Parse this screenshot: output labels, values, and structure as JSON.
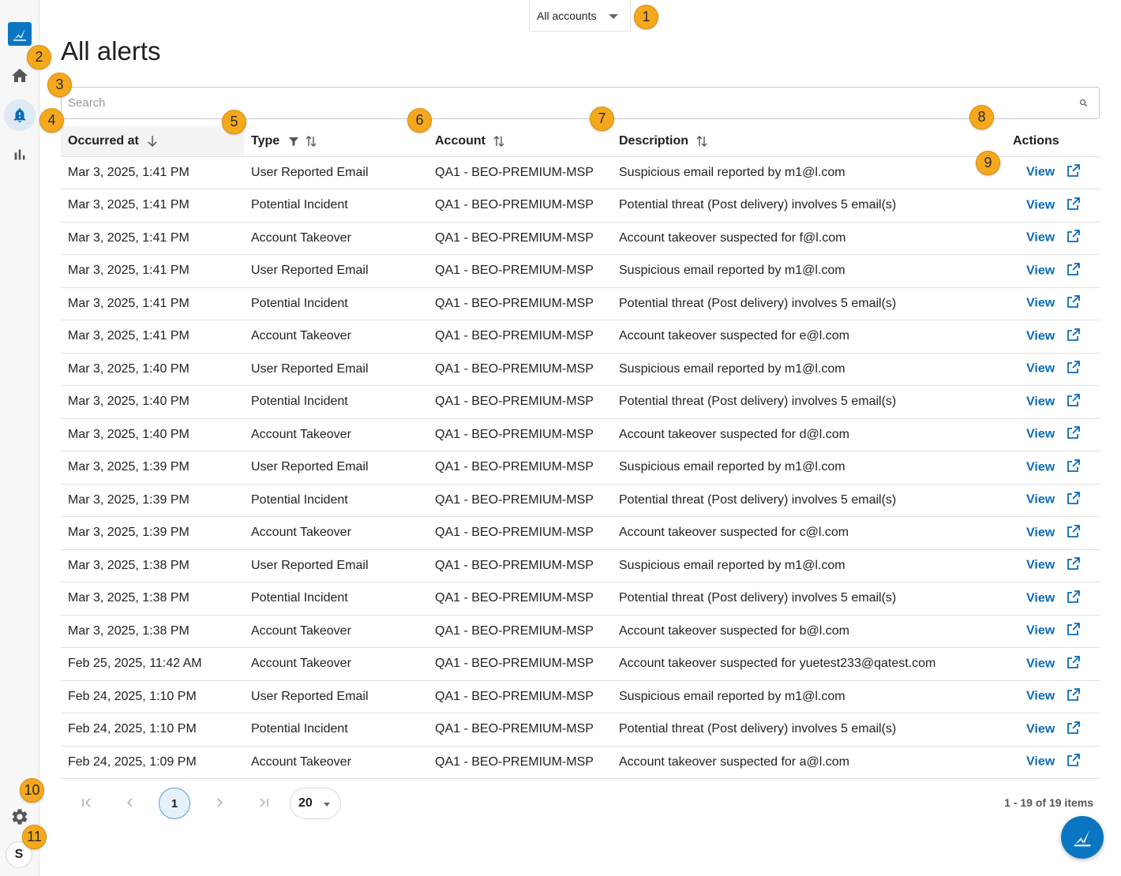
{
  "account_selector": {
    "value": "All accounts"
  },
  "page": {
    "title": "All alerts"
  },
  "search": {
    "placeholder": "Search"
  },
  "table": {
    "columns": [
      "Occurred at",
      "Type",
      "Account",
      "Description",
      "Actions"
    ],
    "rows": [
      {
        "occurred": "Mar 3, 2025, 1:41 PM",
        "type": "User Reported Email",
        "account": "QA1 - BEO-PREMIUM-MSP",
        "description": "Suspicious email reported by m1@l.com",
        "action": "View"
      },
      {
        "occurred": "Mar 3, 2025, 1:41 PM",
        "type": "Potential Incident",
        "account": "QA1 - BEO-PREMIUM-MSP",
        "description": "Potential threat (Post delivery) involves 5 email(s)",
        "action": "View"
      },
      {
        "occurred": "Mar 3, 2025, 1:41 PM",
        "type": "Account Takeover",
        "account": "QA1 - BEO-PREMIUM-MSP",
        "description": "Account takeover suspected for f@l.com",
        "action": "View"
      },
      {
        "occurred": "Mar 3, 2025, 1:41 PM",
        "type": "User Reported Email",
        "account": "QA1 - BEO-PREMIUM-MSP",
        "description": "Suspicious email reported by m1@l.com",
        "action": "View"
      },
      {
        "occurred": "Mar 3, 2025, 1:41 PM",
        "type": "Potential Incident",
        "account": "QA1 - BEO-PREMIUM-MSP",
        "description": "Potential threat (Post delivery) involves 5 email(s)",
        "action": "View"
      },
      {
        "occurred": "Mar 3, 2025, 1:41 PM",
        "type": "Account Takeover",
        "account": "QA1 - BEO-PREMIUM-MSP",
        "description": "Account takeover suspected for e@l.com",
        "action": "View"
      },
      {
        "occurred": "Mar 3, 2025, 1:40 PM",
        "type": "User Reported Email",
        "account": "QA1 - BEO-PREMIUM-MSP",
        "description": "Suspicious email reported by m1@l.com",
        "action": "View"
      },
      {
        "occurred": "Mar 3, 2025, 1:40 PM",
        "type": "Potential Incident",
        "account": "QA1 - BEO-PREMIUM-MSP",
        "description": "Potential threat (Post delivery) involves 5 email(s)",
        "action": "View"
      },
      {
        "occurred": "Mar 3, 2025, 1:40 PM",
        "type": "Account Takeover",
        "account": "QA1 - BEO-PREMIUM-MSP",
        "description": "Account takeover suspected for d@l.com",
        "action": "View"
      },
      {
        "occurred": "Mar 3, 2025, 1:39 PM",
        "type": "User Reported Email",
        "account": "QA1 - BEO-PREMIUM-MSP",
        "description": "Suspicious email reported by m1@l.com",
        "action": "View"
      },
      {
        "occurred": "Mar 3, 2025, 1:39 PM",
        "type": "Potential Incident",
        "account": "QA1 - BEO-PREMIUM-MSP",
        "description": "Potential threat (Post delivery) involves 5 email(s)",
        "action": "View"
      },
      {
        "occurred": "Mar 3, 2025, 1:39 PM",
        "type": "Account Takeover",
        "account": "QA1 - BEO-PREMIUM-MSP",
        "description": "Account takeover suspected for c@l.com",
        "action": "View"
      },
      {
        "occurred": "Mar 3, 2025, 1:38 PM",
        "type": "User Reported Email",
        "account": "QA1 - BEO-PREMIUM-MSP",
        "description": "Suspicious email reported by m1@l.com",
        "action": "View"
      },
      {
        "occurred": "Mar 3, 2025, 1:38 PM",
        "type": "Potential Incident",
        "account": "QA1 - BEO-PREMIUM-MSP",
        "description": "Potential threat (Post delivery) involves 5 email(s)",
        "action": "View"
      },
      {
        "occurred": "Mar 3, 2025, 1:38 PM",
        "type": "Account Takeover",
        "account": "QA1 - BEO-PREMIUM-MSP",
        "description": "Account takeover suspected for b@l.com",
        "action": "View"
      },
      {
        "occurred": "Feb 25, 2025, 11:42 AM",
        "type": "Account Takeover",
        "account": "QA1 - BEO-PREMIUM-MSP",
        "description": "Account takeover suspected for yuetest233@qatest.com",
        "action": "View"
      },
      {
        "occurred": "Feb 24, 2025, 1:10 PM",
        "type": "User Reported Email",
        "account": "QA1 - BEO-PREMIUM-MSP",
        "description": "Suspicious email reported by m1@l.com",
        "action": "View"
      },
      {
        "occurred": "Feb 24, 2025, 1:10 PM",
        "type": "Potential Incident",
        "account": "QA1 - BEO-PREMIUM-MSP",
        "description": "Potential threat (Post delivery) involves 5 email(s)",
        "action": "View"
      },
      {
        "occurred": "Feb 24, 2025, 1:09 PM",
        "type": "Account Takeover",
        "account": "QA1 - BEO-PREMIUM-MSP",
        "description": "Account takeover suspected for a@l.com",
        "action": "View"
      }
    ]
  },
  "pagination": {
    "current_page": "1",
    "page_size": "20",
    "info": "1 - 19 of 19 items"
  },
  "sidebar": {
    "items": [
      {
        "name": "home",
        "icon": "home-icon"
      },
      {
        "name": "alerts",
        "icon": "bell-alert-icon",
        "active": true
      },
      {
        "name": "reports",
        "icon": "bar-chart-icon"
      }
    ],
    "avatar_initial": "S"
  },
  "callouts": [
    "1",
    "2",
    "3",
    "4",
    "5",
    "6",
    "7",
    "8",
    "9",
    "10",
    "11"
  ],
  "colors": {
    "accent": "#0a76c2",
    "link": "#0a6bb7",
    "callout": "#f6a81c"
  }
}
